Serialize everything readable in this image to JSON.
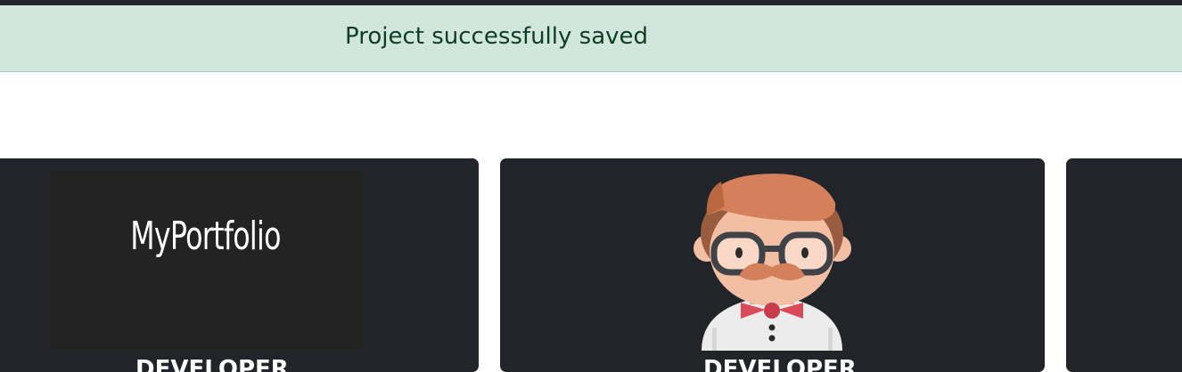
{
  "alert": {
    "message": "Project successfully saved",
    "background": "#d1e7dd",
    "text_color": "#0f3d23"
  },
  "projects": [
    {
      "thumbnail_text": "MyPortfolio",
      "title": "DEVELOPER"
    },
    {
      "thumbnail_icon": "developer-avatar-icon",
      "title": "DEVELOPER"
    },
    {
      "title": ""
    }
  ],
  "colors": {
    "card_background": "#212529",
    "topbar": "#212529"
  }
}
